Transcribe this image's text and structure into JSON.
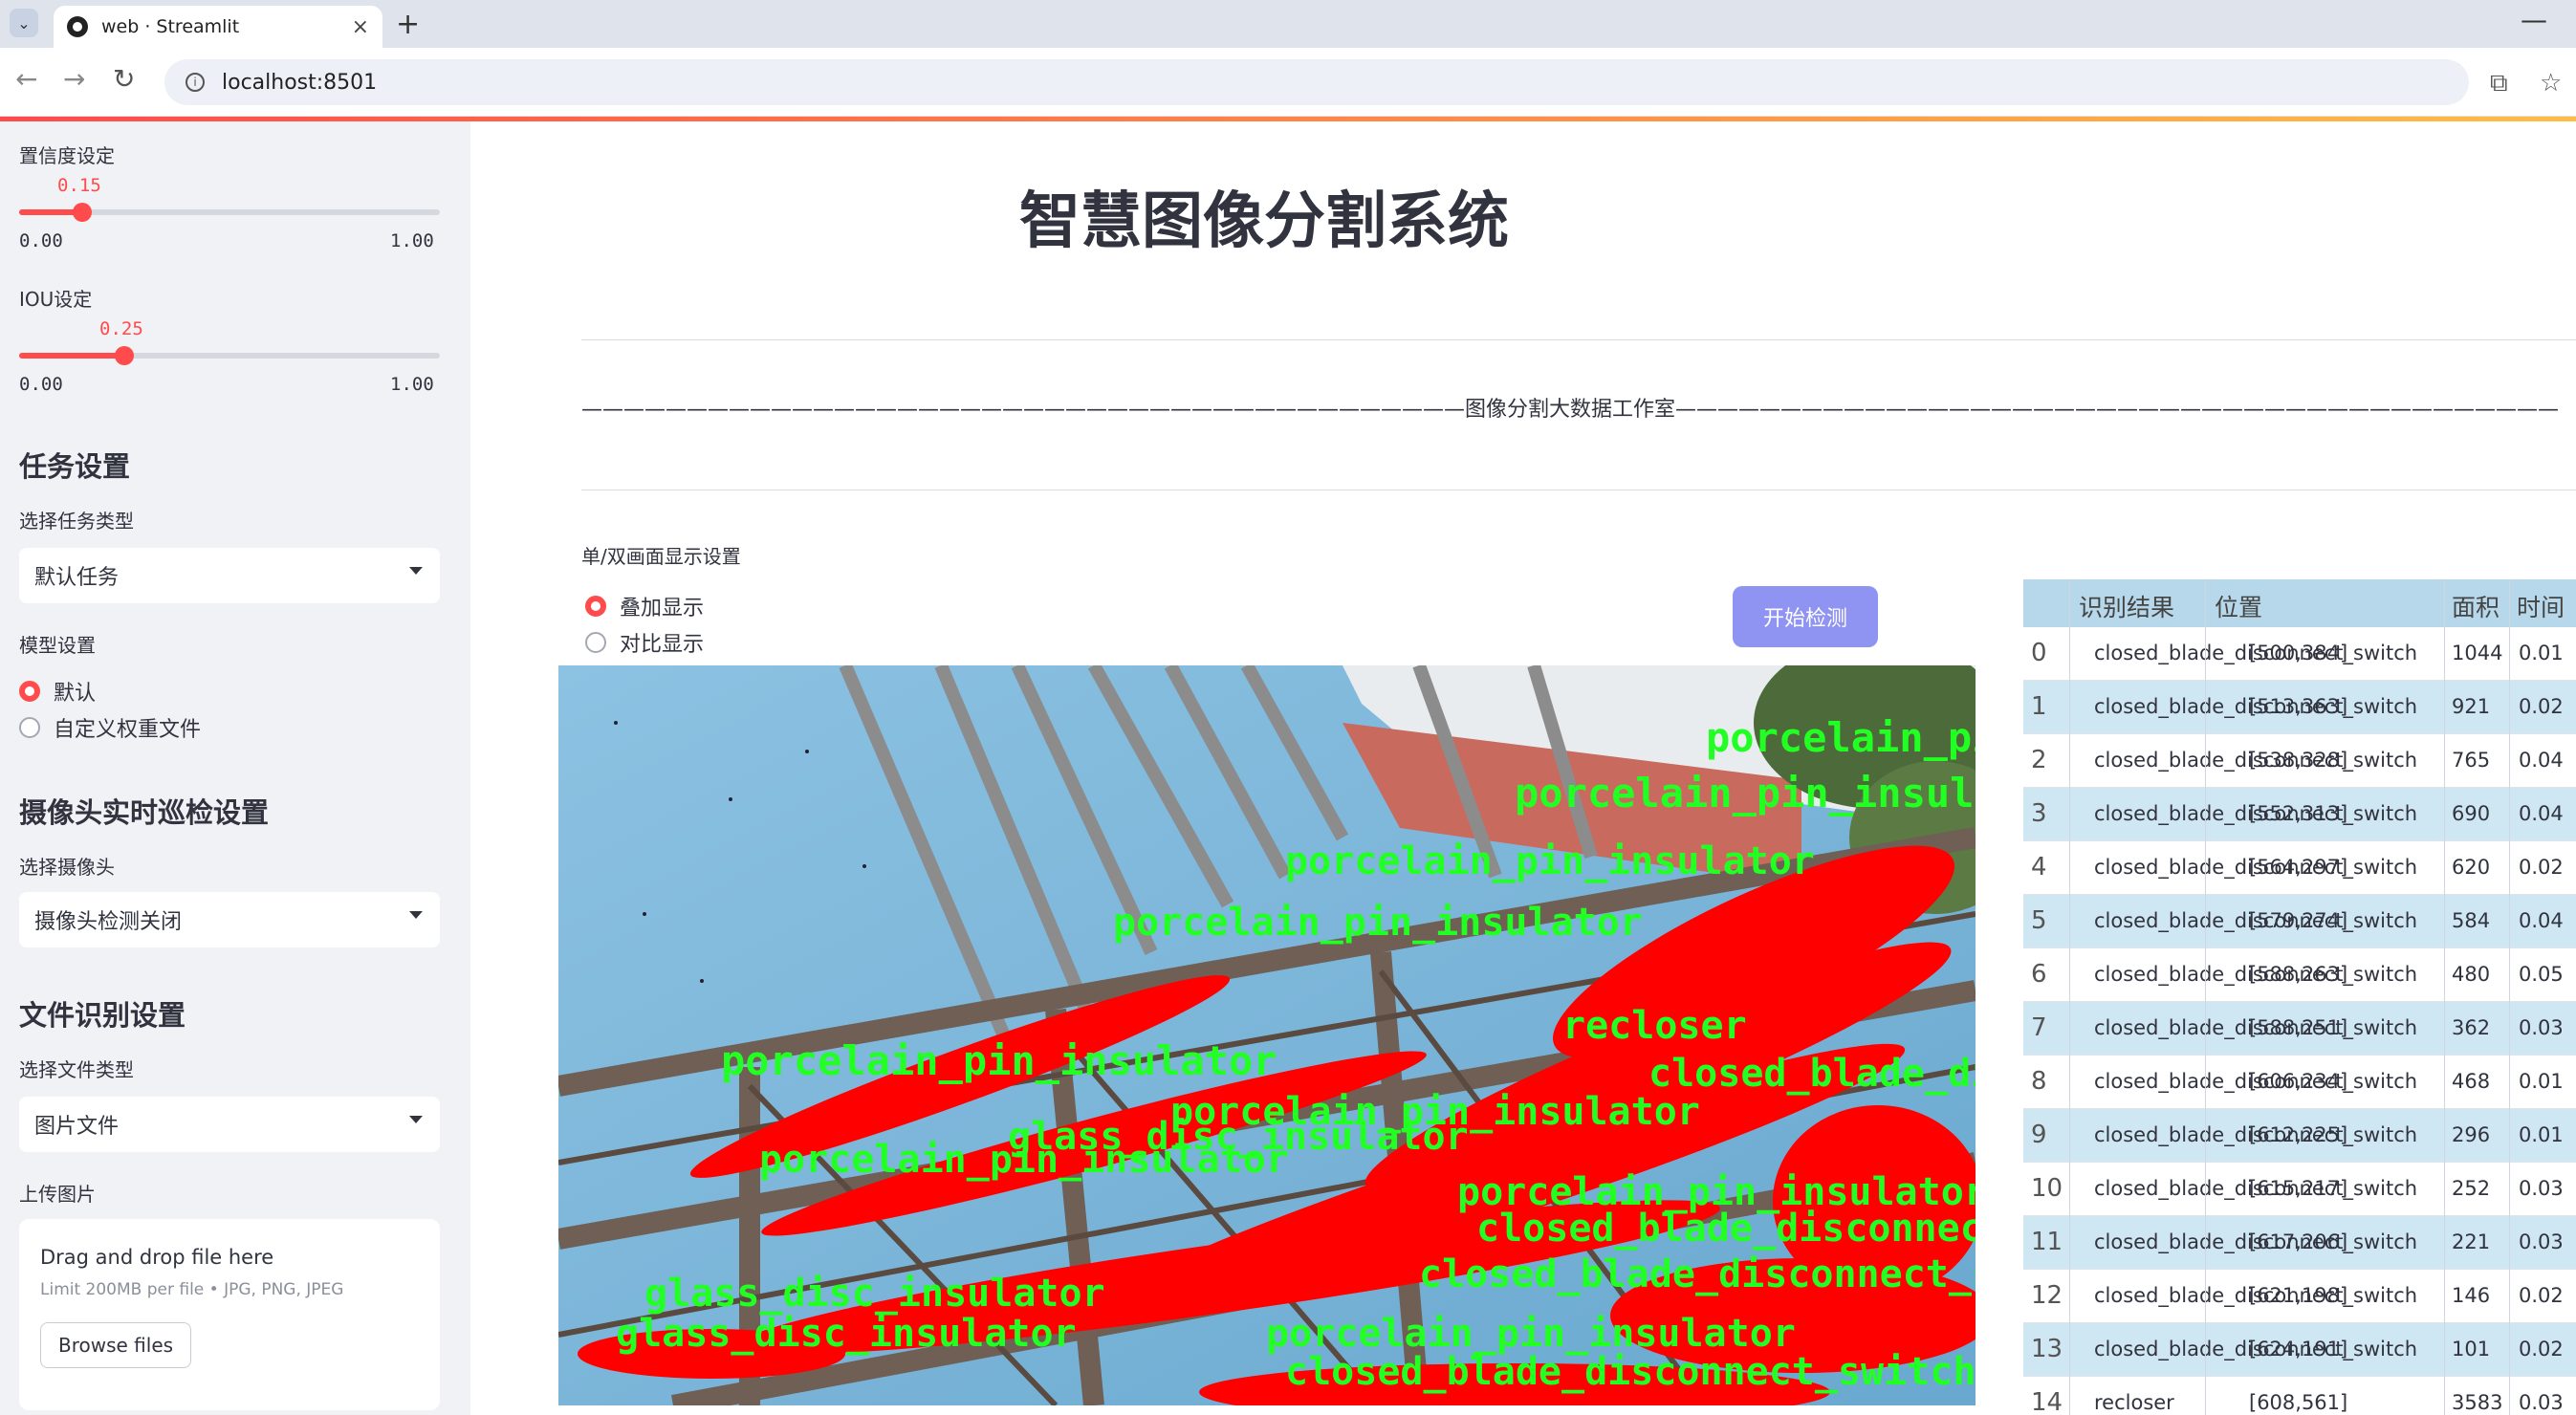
{
  "browser": {
    "tab_title": "web · Streamlit",
    "url": "localhost:8501"
  },
  "sidebar": {
    "confidence": {
      "label": "置信度设定",
      "value": "0.15",
      "min": "0.00",
      "max": "1.00",
      "fraction": 0.15
    },
    "iou": {
      "label": "IOU设定",
      "value": "0.25",
      "min": "0.00",
      "max": "1.00",
      "fraction": 0.25
    },
    "task_section": "任务设置",
    "task_type_label": "选择任务类型",
    "task_type_value": "默认任务",
    "model_label": "模型设置",
    "model_options": [
      "默认",
      "自定义权重文件"
    ],
    "model_selected": 0,
    "camera_section": "摄像头实时巡检设置",
    "camera_label": "选择摄像头",
    "camera_value": "摄像头检测关闭",
    "file_section": "文件识别设置",
    "file_type_label": "选择文件类型",
    "file_type_value": "图片文件",
    "upload_label": "上传图片",
    "upload_title": "Drag and drop file here",
    "upload_sub": "Limit 200MB per file • JPG, PNG, JPEG",
    "browse_label": "Browse files"
  },
  "main": {
    "title": "智慧图像分割系统",
    "banner": "——————————————————————————————————————————图像分割大数据工作室——————————————————————————————————————————",
    "display_label": "单/双画面显示设置",
    "display_options": [
      "叠加显示",
      "对比显示"
    ],
    "display_selected": 0,
    "start_button": "开始检测",
    "overlay_labels": [
      "porcelain_pin_insulator",
      "glass_disc_insulator",
      "closed_blade_disconnect_switch",
      "recloser"
    ]
  },
  "results_table": {
    "headers": [
      "识别结果",
      "位置",
      "面积",
      "时间"
    ],
    "rows": [
      {
        "idx": "0",
        "result": "closed_blade_disconnect_switch",
        "pos": "[500,384]",
        "area": "1044",
        "time": "0.01"
      },
      {
        "idx": "1",
        "result": "closed_blade_disconnect_switch",
        "pos": "[513,363]",
        "area": "921",
        "time": "0.02"
      },
      {
        "idx": "2",
        "result": "closed_blade_disconnect_switch",
        "pos": "[538,328]",
        "area": "765",
        "time": "0.04"
      },
      {
        "idx": "3",
        "result": "closed_blade_disconnect_switch",
        "pos": "[552,313]",
        "area": "690",
        "time": "0.04"
      },
      {
        "idx": "4",
        "result": "closed_blade_disconnect_switch",
        "pos": "[564,297]",
        "area": "620",
        "time": "0.02"
      },
      {
        "idx": "5",
        "result": "closed_blade_disconnect_switch",
        "pos": "[579,274]",
        "area": "584",
        "time": "0.04"
      },
      {
        "idx": "6",
        "result": "closed_blade_disconnect_switch",
        "pos": "[588,263]",
        "area": "480",
        "time": "0.05"
      },
      {
        "idx": "7",
        "result": "closed_blade_disconnect_switch",
        "pos": "[588,251]",
        "area": "362",
        "time": "0.03"
      },
      {
        "idx": "8",
        "result": "closed_blade_disconnect_switch",
        "pos": "[606,234]",
        "area": "468",
        "time": "0.01"
      },
      {
        "idx": "9",
        "result": "closed_blade_disconnect_switch",
        "pos": "[612,225]",
        "area": "296",
        "time": "0.01"
      },
      {
        "idx": "10",
        "result": "closed_blade_disconnect_switch",
        "pos": "[615,217]",
        "area": "252",
        "time": "0.03"
      },
      {
        "idx": "11",
        "result": "closed_blade_disconnect_switch",
        "pos": "[617,206]",
        "area": "221",
        "time": "0.03"
      },
      {
        "idx": "12",
        "result": "closed_blade_disconnect_switch",
        "pos": "[621,198]",
        "area": "146",
        "time": "0.02"
      },
      {
        "idx": "13",
        "result": "closed_blade_disconnect_switch",
        "pos": "[624,191]",
        "area": "101",
        "time": "0.02"
      },
      {
        "idx": "14",
        "result": "recloser",
        "pos": "[608,561]",
        "area": "3583",
        "time": "0.03"
      }
    ]
  },
  "colors": {
    "accent": "#ff4b4b",
    "mask_red": "#ff0000",
    "label_green": "#22ff22",
    "table_header": "#b6d8ea",
    "button": "#8f94f2"
  }
}
